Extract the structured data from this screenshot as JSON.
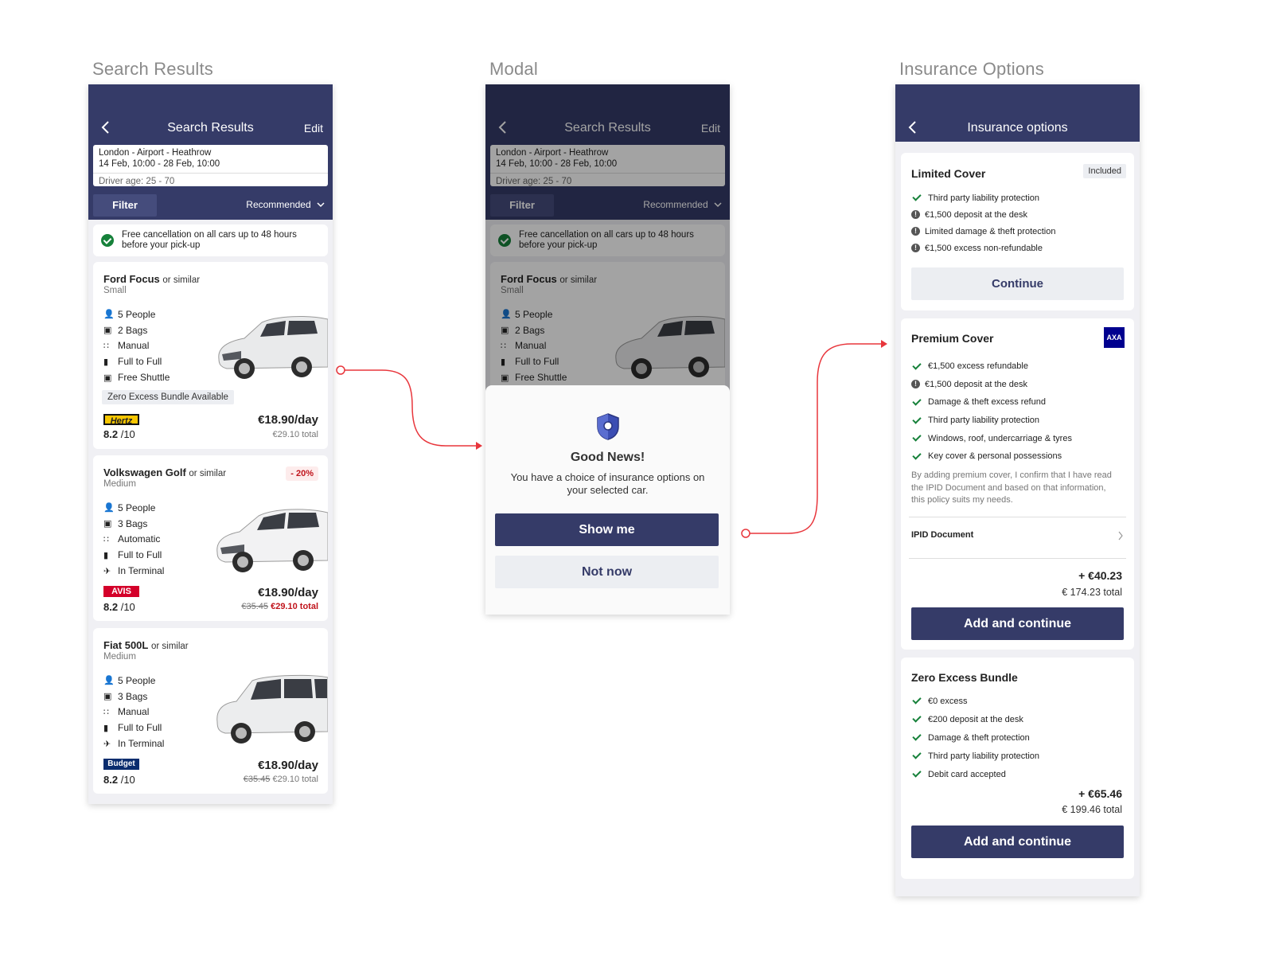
{
  "screens": {
    "search": {
      "label": "Search Results",
      "nav_title": "Search Results",
      "edit_label": "Edit",
      "location": "London - Airport - Heathrow",
      "dates": "14 Feb, 10:00 - 28 Feb, 10:00",
      "driver_age": "Driver age: 25 - 70",
      "filter_label": "Filter",
      "sort_label": "Recommended",
      "notice": "Free cancellation on all cars up to 48 hours before your pick-up",
      "cars": [
        {
          "name": "Ford Focus",
          "similar": "or similar",
          "class": "Small",
          "features": [
            "5 People",
            "2 Bags",
            "Manual",
            "Full to Full",
            "Free Shuttle"
          ],
          "bundle": "Zero Excess Bundle Available",
          "supplier": "Hertz",
          "rating": "8.2",
          "rating_scale": "/10",
          "price": "€18.90/day",
          "total": "€29.10 total"
        },
        {
          "name": "Volkswagen Golf",
          "similar": "or similar",
          "class": "Medium",
          "discount": "- 20%",
          "features": [
            "5 People",
            "3 Bags",
            "Automatic",
            "Full to Full",
            "In Terminal"
          ],
          "supplier": "AVIS",
          "rating": "8.2",
          "rating_scale": "/10",
          "price": "€18.90/day",
          "old_total": "€35.45",
          "total": "€29.10 total"
        },
        {
          "name": "Fiat 500L",
          "similar": "or similar",
          "class": "Medium",
          "features": [
            "5 People",
            "3 Bags",
            "Manual",
            "Full to Full",
            "In Terminal"
          ],
          "supplier": "Budget",
          "rating": "8.2",
          "rating_scale": "/10",
          "price": "€18.90/day",
          "old_total": "€35.45",
          "total": "€29.10 total"
        }
      ]
    },
    "modal": {
      "label": "Modal",
      "title": "Good News!",
      "text": "You have a choice of insurance options on your selected car.",
      "primary": "Show me",
      "secondary": "Not now"
    },
    "insurance": {
      "label": "Insurance Options",
      "nav_title": "Insurance options",
      "limited": {
        "title": "Limited Cover",
        "badge": "Included",
        "items": [
          {
            "icon": "check",
            "text": "Third party liability protection"
          },
          {
            "icon": "warn",
            "text": "€1,500 deposit at the desk"
          },
          {
            "icon": "warn",
            "text": "Limited damage & theft protection"
          },
          {
            "icon": "warn",
            "text": "€1,500 excess non-refundable"
          }
        ],
        "button": "Continue"
      },
      "premium": {
        "title": "Premium Cover",
        "logo": "AXA",
        "items": [
          {
            "icon": "check",
            "text": "€1,500 excess refundable"
          },
          {
            "icon": "warn",
            "text": "€1,500 deposit at the desk"
          },
          {
            "icon": "check",
            "text": "Damage & theft excess refund"
          },
          {
            "icon": "check",
            "text": "Third party liability protection"
          },
          {
            "icon": "check",
            "text": "Windows, roof, undercarriage & tyres"
          },
          {
            "icon": "check",
            "text": "Key cover & personal possessions"
          }
        ],
        "disclaimer": "By adding premium cover, I confirm that I have read the IPID Document and based on that information, this policy suits my needs.",
        "ipid": "IPID Document",
        "price": "+ €40.23",
        "total": "€ 174.23 total",
        "button": "Add and continue"
      },
      "zero": {
        "title": "Zero Excess Bundle",
        "items": [
          {
            "icon": "check",
            "text": "€0 excess"
          },
          {
            "icon": "check",
            "text": "€200 deposit at the desk"
          },
          {
            "icon": "check",
            "text": "Damage & theft protection"
          },
          {
            "icon": "check",
            "text": "Third party liability protection"
          },
          {
            "icon": "check",
            "text": "Debit card accepted"
          }
        ],
        "price": "+ €65.46",
        "total": "€ 199.46 total",
        "button": "Add and continue"
      }
    }
  },
  "colors": {
    "nav": "#353b68",
    "accent": "#e8363c",
    "success": "#16813a",
    "discount": "#c0141c",
    "hertz": "#f7c600",
    "avis": "#d4002a",
    "budget": "#0a2d6e",
    "axa": "#00008f"
  },
  "icons": {
    "feature_icons": [
      "person-icon",
      "bag-icon",
      "gearbox-icon",
      "fuel-icon",
      "bus-icon",
      "plane-icon"
    ]
  }
}
